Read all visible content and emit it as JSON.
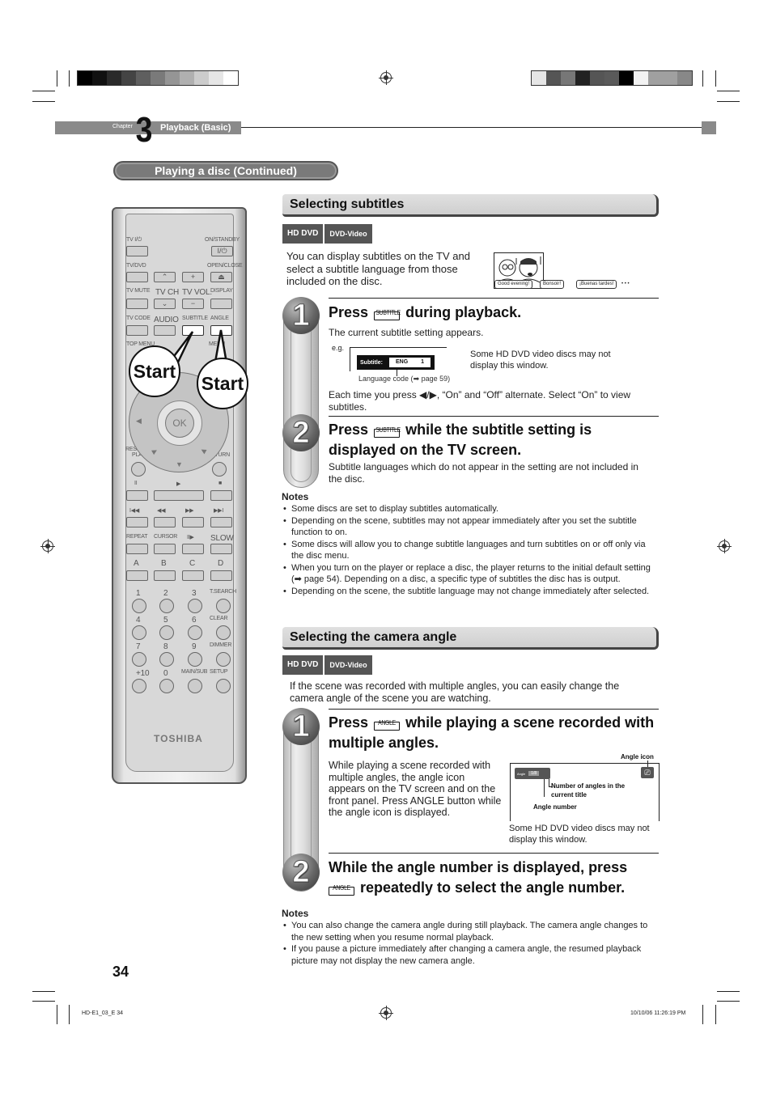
{
  "page": {
    "chapter_label": "Chapter",
    "chapter_number": "3",
    "chapter_title": "Playback (Basic)",
    "section_pill": "Playing a disc (Continued)",
    "page_number": "34",
    "footer_left": "HD-E1_03_E  34",
    "footer_right": "10/10/06  11:26:19 PM"
  },
  "calibration": {
    "left_swatches": [
      "#000000",
      "#111111",
      "#2a2a2a",
      "#444444",
      "#5f5f5f",
      "#7a7a7a",
      "#959595",
      "#b0b0b0",
      "#cccccc",
      "#e6e6e6",
      "#ffffff"
    ],
    "right_swatches": [
      "#e6e6e6",
      "#555555",
      "#777777",
      "#222222",
      "#555555",
      "#5a5a5a",
      "#000000",
      "#f2f2f2",
      "#a0a0a0",
      "#a0a0a0",
      "#888888"
    ]
  },
  "remote": {
    "brand": "TOSHIBA",
    "row1": {
      "left": "TV I/⏻",
      "right": "ON/STANDBY",
      "power_glyph": "I/⏻"
    },
    "row2": {
      "left": "TV/DVD",
      "right": "OPEN/CLOSE",
      "eject": "⏏",
      "ch_up": "⌃",
      "vol_up": "+"
    },
    "row3": [
      "TV MUTE",
      "TV CH",
      "TV VOL.",
      "DISPLAY"
    ],
    "row3_glyphs": {
      "ch_down": "⌄",
      "vol_down": "−"
    },
    "row4": [
      "TV CODE",
      "AUDIO",
      "SUBTITLE",
      "ANGLE"
    ],
    "row5": [
      "TOP MENU",
      "MENU"
    ],
    "ok": "OK",
    "resume": "RESUME\nPLAY",
    "resume_line1": "RESUME",
    "resume_line2": "PLAY",
    "return": "RETURN",
    "transport1": [
      "II",
      "▶",
      "■"
    ],
    "transport2": [
      "I◀◀",
      "◀◀",
      "▶▶",
      "▶▶I"
    ],
    "row_repeat": [
      "REPEAT",
      "CURSOR",
      "II▶",
      "SLOW"
    ],
    "row_abcd": [
      "A",
      "B",
      "C",
      "D"
    ],
    "num_rows": [
      [
        "1",
        "2",
        "3",
        "T.SEARCH"
      ],
      [
        "4",
        "5",
        "6",
        "CLEAR"
      ],
      [
        "7",
        "8",
        "9",
        "DIMMER"
      ],
      [
        "+10",
        "0",
        "MAIN/SUB",
        "SETUP"
      ]
    ],
    "callouts": [
      "Start",
      "Start"
    ]
  },
  "subtitles": {
    "heading": "Selecting subtitles",
    "badges": [
      "HD DVD",
      "DVD-Video"
    ],
    "intro": "You can display subtitles on the TV and select a subtitle language from those included on the disc.",
    "comic_bubbles": [
      "Good evening!",
      "Bonsoir!",
      "¡Buenas tardes!"
    ],
    "comic_ellipsis": "• • •",
    "step1": {
      "number": "1",
      "press": "Press",
      "button_label": "SUBTITLE",
      "title_rest": "during playback.",
      "desc": "The current subtitle setting appears.",
      "eg_label": "e.g.",
      "osd_label": "Subtitle:",
      "osd_lang": "ENG",
      "osd_num": "1",
      "lang_code_caption": "Language code (",
      "lang_code_page": "page 59)",
      "side_note": "Some HD DVD video discs may not display this window.",
      "toggle_text": "Each time you press ◀/▶, “On” and “Off” alternate. Select “On” to view subtitles."
    },
    "step2": {
      "number": "2",
      "press": "Press",
      "button_label": "SUBTITLE",
      "title_rest_1": "while the subtitle setting is",
      "title_rest_2": "displayed on the TV screen.",
      "desc": "Subtitle languages which do not appear in the setting are not included in the disc."
    },
    "notes_heading": "Notes",
    "notes": [
      "Some discs are set to display subtitles automatically.",
      "Depending on the scene, subtitles may not appear immediately after you set the subtitle function to on.",
      "Some discs will allow you to change subtitle languages and turn subtitles on or off only via the disc menu.",
      "When you turn on the player or replace a disc, the player returns to the initial default setting (➡ page 54). Depending on a disc, a specific type of subtitles the disc has is output.",
      "Depending on the scene, the subtitle language may not change immediately after selected."
    ]
  },
  "angle": {
    "heading": "Selecting the camera angle",
    "badges": [
      "HD DVD",
      "DVD-Video"
    ],
    "intro": "If the scene was recorded with multiple angles, you can easily change the camera angle of the scene you are watching.",
    "step1": {
      "number": "1",
      "press": "Press",
      "button_label": "ANGLE",
      "title_rest_1": "while playing a scene recorded with",
      "title_rest_2": "multiple angles.",
      "desc": "While playing a scene recorded with multiple angles, the angle icon appears on the TV screen and on the front panel. Press ANGLE button while the angle icon is displayed.",
      "osd_label": "Angle",
      "osd_value": "1/8",
      "angle_icon_label": "Angle icon",
      "num_angles_label_1": "Number of angles in the",
      "num_angles_label_2": "current title",
      "angle_number_label": "Angle number",
      "side_note": "Some HD DVD video discs may not display this window."
    },
    "step2": {
      "number": "2",
      "title_1": "While the angle number is displayed, press",
      "button_label": "ANGLE",
      "title_2": "repeatedly to select the angle number."
    },
    "notes_heading": "Notes",
    "notes": [
      "You can also change the camera angle during still playback. The camera angle changes to the new setting when you resume normal playback.",
      "If you pause a picture immediately after changing a camera angle, the resumed playback picture may not display the new camera angle."
    ]
  }
}
